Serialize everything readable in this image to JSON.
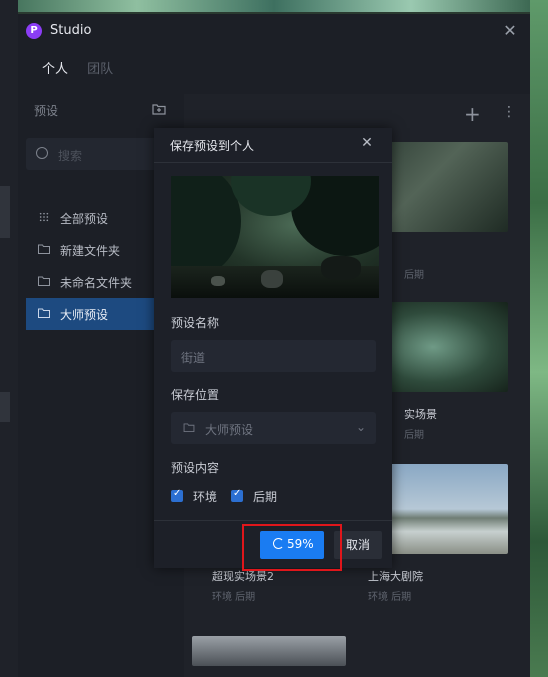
{
  "window": {
    "title": "Studio",
    "logo_letter": "P"
  },
  "tabs": [
    {
      "label": "个人"
    },
    {
      "label": "团队"
    }
  ],
  "sidebar": {
    "header": "预设",
    "search_placeholder": "搜索",
    "items": [
      {
        "label": "全部预设",
        "icon": "grid-icon"
      },
      {
        "label": "新建文件夹",
        "icon": "folder-icon"
      },
      {
        "label": "未命名文件夹",
        "icon": "folder-icon"
      },
      {
        "label": "大师预设",
        "icon": "folder-icon",
        "active": true
      }
    ]
  },
  "cards": [
    {
      "name": "",
      "tags": "后期"
    },
    {
      "name": "实场景",
      "tags": "后期"
    },
    {
      "name": "超现实场景2",
      "tags": "环境 后期"
    },
    {
      "name": "上海大剧院",
      "tags": "环境 后期"
    }
  ],
  "dialog": {
    "title": "保存预设到个人",
    "name_label": "预设名称",
    "name_value": "街道",
    "location_label": "保存位置",
    "location_value": "大师预设",
    "content_label": "预设内容",
    "checks": [
      {
        "label": "环境",
        "checked": true
      },
      {
        "label": "后期",
        "checked": true
      }
    ],
    "progress_text": "59%",
    "progress_value": 59,
    "cancel_label": "取消"
  },
  "colors": {
    "accent": "#1a7cf2",
    "active_nav": "#1d4a80",
    "highlight": "#e0161b"
  }
}
